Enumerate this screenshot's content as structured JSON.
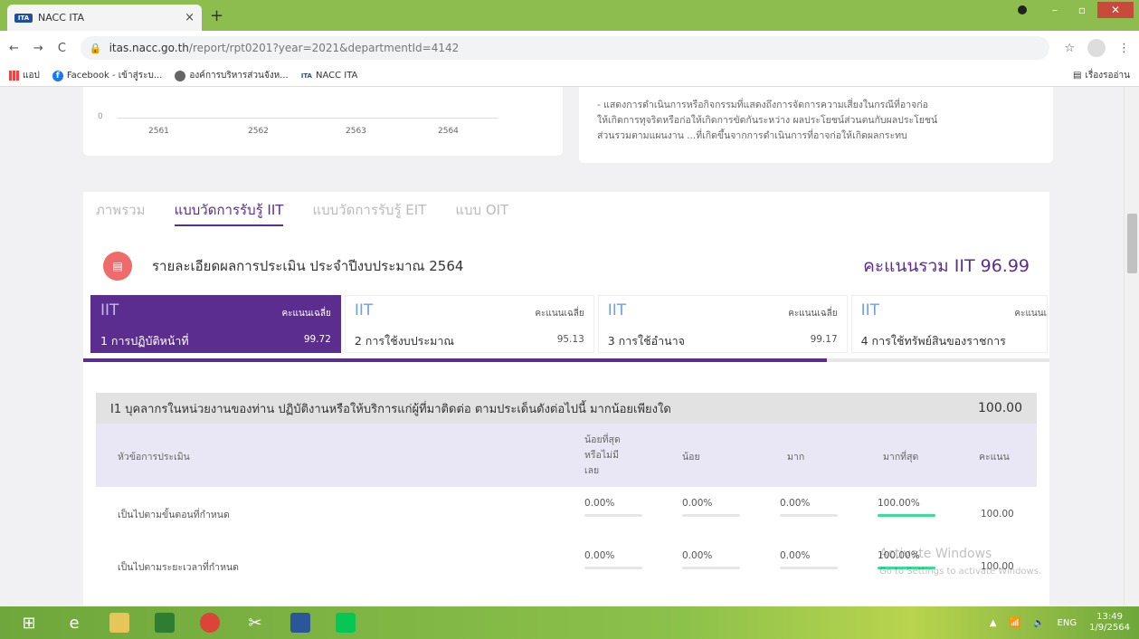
{
  "browser": {
    "tab_title": "NACC ITA",
    "tab_icon_text": "ITA",
    "url_host": "itas.nacc.go.th",
    "url_path": "/report/rpt0201?year=2021&departmentId=4142",
    "bookmarks": [
      {
        "label": "แอป",
        "icon": "apps-grid-icon"
      },
      {
        "label": "Facebook - เข้าสู่ระบ...",
        "icon": "facebook-icon"
      },
      {
        "label": "องค์การบริหารส่วนจังห...",
        "icon": "globe-icon"
      },
      {
        "label": "NACC ITA",
        "icon": "ita-icon"
      }
    ],
    "reading_list": "เรื่องรออ่าน"
  },
  "chart_card": {
    "zero_label": "0",
    "x_ticks": [
      "2561",
      "2562",
      "2563",
      "2564"
    ]
  },
  "text_card": {
    "lines": [
      "- แสดงการดำเนินการหรือกิจกรรมที่แสดงถึงการจัดการความเสี่ยงในกรณีที่อาจก่อ",
      "ให้เกิดการทุจริตหรือก่อให้เกิดการขัดกันระหว่าง ผลประโยชน์ส่วนตนกับผลประโยชน์",
      "ส่วนรวมตามแผนงาน ...ที่เกิดขึ้นจากการดำเนินการที่อาจก่อให้เกิดผลกระทบ"
    ]
  },
  "tabs": [
    {
      "label": "ภาพรวม",
      "active": false
    },
    {
      "label": "แบบวัดการรับรู้ IIT",
      "active": true
    },
    {
      "label": "แบบวัดการรับรู้ EIT",
      "active": false
    },
    {
      "label": "แบบ OIT",
      "active": false
    }
  ],
  "summary": {
    "title": "รายละเอียดผลการประเมิน ประจำปีงบประมาณ 2564",
    "total_label": "คะแนนรวม IIT 96.99"
  },
  "scorecards": [
    {
      "prefix": "IIT",
      "avg_label": "คะแนนเฉลี่ย",
      "name": "1 การปฏิบัติหน้าที่",
      "score": "99.72",
      "active": true
    },
    {
      "prefix": "IIT",
      "avg_label": "คะแนนเฉลี่ย",
      "name": "2 การใช้งบประมาณ",
      "score": "95.13",
      "active": false
    },
    {
      "prefix": "IIT",
      "avg_label": "คะแนนเฉลี่ย",
      "name": "3 การใช้อำนาจ",
      "score": "99.17",
      "active": false
    },
    {
      "prefix": "IIT",
      "avg_label": "คะแนนเ",
      "name": "4 การใช้ทรัพย์สินของราชการ",
      "score": "",
      "active": false
    }
  ],
  "scroll_progress": 0.77,
  "question": {
    "text": "I1 บุคลากรในหน่วยงานของท่าน ปฏิบัติงานหรือให้บริการแก่ผู้ที่มาติดต่อ ตามประเด็นดังต่อไปนี้ มากน้อยเพียงใด",
    "score": "100.00"
  },
  "table": {
    "headers": {
      "topic": "หัวข้อการประเมิน",
      "least1": "น้อยที่สุด",
      "least2": "หรือไม่มี",
      "least3": "เลย",
      "little": "น้อย",
      "much": "มาก",
      "most": "มากที่สุด",
      "score": "คะแนน"
    },
    "rows": [
      {
        "topic": "เป็นไปตามขั้นตอนที่กำหนด",
        "least": "0.00%",
        "little": "0.00%",
        "much": "0.00%",
        "most": "100.00%",
        "score": "100.00",
        "least_fill": 0,
        "little_fill": 0,
        "much_fill": 0,
        "most_fill": 1
      },
      {
        "topic": "เป็นไปตามระยะเวลาที่กำหนด",
        "least": "0.00%",
        "little": "0.00%",
        "much": "0.00%",
        "most": "100.00%",
        "score": "100.00",
        "least_fill": 0,
        "little_fill": 0,
        "much_fill": 0,
        "most_fill": 1
      }
    ]
  },
  "watermark": {
    "line1": "Activate Windows",
    "line2": "Go to Settings to activate Windows."
  },
  "taskbar": {
    "lang": "ENG",
    "time": "13:49",
    "date": "1/9/2564"
  }
}
